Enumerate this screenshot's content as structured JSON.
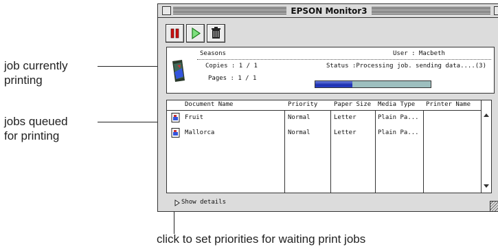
{
  "annotations": {
    "current_job": [
      "job currently",
      "printing"
    ],
    "queued_jobs": [
      "jobs queued",
      "for printing"
    ],
    "details_hint": "click to set priorities for waiting print jobs"
  },
  "window": {
    "title": "EPSON Monitor3"
  },
  "toolbar": {
    "pause_icon": "pause-icon",
    "resume_icon": "play-icon",
    "delete_icon": "trash-icon"
  },
  "current_job": {
    "document": "Seasons",
    "user": "User : Macbeth",
    "copies": "Copies : 1 / 1",
    "status": "Status :Processing job. sending data....(3)",
    "pages": "Pages : 1 / 1",
    "progress_fraction": 0.32
  },
  "queue": {
    "columns": [
      "Document Name",
      "Priority",
      "Paper Size",
      "Media Type",
      "Printer Name"
    ],
    "rows": [
      {
        "name": "Fruit",
        "priority": "Normal",
        "paper": "Letter",
        "media": "Plain Pa...",
        "printer": ""
      },
      {
        "name": "Mallorca",
        "priority": "Normal",
        "paper": "Letter",
        "media": "Plain Pa...",
        "printer": ""
      }
    ]
  },
  "footer": {
    "details_label": "Show details"
  },
  "colors": {
    "progress": "#1d2fb0",
    "pause": "#cc1111",
    "play": "#22aa22"
  }
}
